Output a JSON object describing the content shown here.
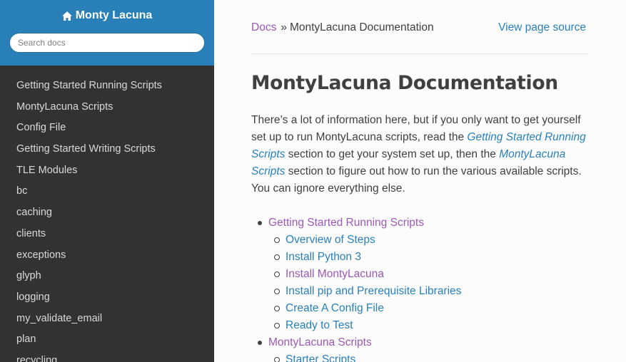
{
  "sidebar": {
    "brand": "Monty Lacuna",
    "brand_icon": "home-icon",
    "search_placeholder": "Search docs",
    "items": [
      {
        "label": "Getting Started Running Scripts"
      },
      {
        "label": "MontyLacuna Scripts"
      },
      {
        "label": "Config File"
      },
      {
        "label": "Getting Started Writing Scripts"
      },
      {
        "label": "TLE Modules"
      },
      {
        "label": "bc"
      },
      {
        "label": "caching"
      },
      {
        "label": "clients"
      },
      {
        "label": "exceptions"
      },
      {
        "label": "glyph"
      },
      {
        "label": "logging"
      },
      {
        "label": "my_validate_email"
      },
      {
        "label": "plan"
      },
      {
        "label": "recycling"
      }
    ]
  },
  "breadcrumbs": {
    "docs": "Docs",
    "separator": "»",
    "current": "MontyLacuna Documentation",
    "view_source": "View page source"
  },
  "main": {
    "title": "MontyLacuna Documentation",
    "intro": {
      "p1": "There’s a lot of information here, but if you only want to get yourself set up to run MontyLacuna scripts, read the ",
      "link1": "Getting Started Running Scripts",
      "p2": " section to get your system set up, then the ",
      "link2": "MontyLacuna Scripts",
      "p3": " section to figure out how to run the various available scripts. You can ignore everything else."
    },
    "toc": [
      {
        "label": "Getting Started Running Scripts",
        "children": [
          {
            "label": "Overview of Steps"
          },
          {
            "label": "Install Python 3"
          },
          {
            "label": "Install MontyLacuna"
          },
          {
            "label": "Install pip and Prerequisite Libraries"
          },
          {
            "label": "Create A Config File"
          },
          {
            "label": "Ready to Test"
          }
        ]
      },
      {
        "label": "MontyLacuna Scripts",
        "children": [
          {
            "label": "Starter Scripts"
          }
        ]
      }
    ]
  },
  "colors": {
    "sidebar_bg": "#343131",
    "header_bg": "#2980b9",
    "link": "#2980b9",
    "visited_link": "#9b59b6",
    "text": "#404040"
  }
}
